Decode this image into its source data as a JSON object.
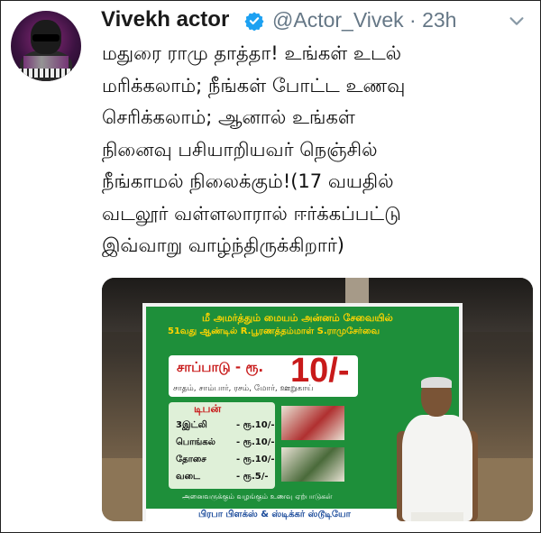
{
  "author": {
    "display_name": "Vivekh actor",
    "handle": "@Actor_Vivek",
    "time": "· 23h",
    "avatar_icon": "avatar-photo",
    "verified_icon": "verified-badge-icon",
    "verified_color": "#1da1f2"
  },
  "tweet": {
    "lines": [
      "மதுரை ராமு தாத்தா! உங்கள் உடல்",
      "மரிக்கலாம்; நீங்கள் போட்ட உணவு",
      "செரிக்கலாம்; ஆனால் உங்கள்",
      "நினைவு பசியாறியவர் நெஞ்சில்",
      "நீங்காமல் நிலைக்கும்!(17 வயதில்",
      "வடலூர் வள்ளலாரால் ஈர்க்கப்பட்டு",
      "இவ்வாறு வாழ்ந்திருக்கிறார்)"
    ]
  },
  "menu": {
    "chevron_icon": "chevron-down-icon"
  },
  "media": {
    "banner_line1": "மீ அமர்த்தும் மையம் அன்னம் சேவையில்",
    "banner_line2": "51வது ஆண்டில் R.பூரணத்தம்மாள் S.ராமுசேர்வை",
    "meal_label": "சாப்பாடு - ரூ.",
    "meal_price": "10/-",
    "meal_items": "சாதம், சாம்பார், ரசம், மோர், ஊறுகாய்",
    "tiffin_label": "டிபன்",
    "tiffin_items": [
      {
        "name": "3இட்லி",
        "price": "- ரூ.10/-"
      },
      {
        "name": "பொங்கல்",
        "price": "- ரூ.10/-"
      },
      {
        "name": "தோசை",
        "price": "- ரூ.10/-"
      },
      {
        "name": "வடை",
        "price": "- ரூ.5/-"
      }
    ],
    "footer_line1": "அனைவருக்கும் வழங்கும் உணவு ஏற்பாடுகள்",
    "footer_line2": "பிரபா பிளக்ஸ் & ஸ்டிக்கர் ஸ்டூடியோ"
  }
}
